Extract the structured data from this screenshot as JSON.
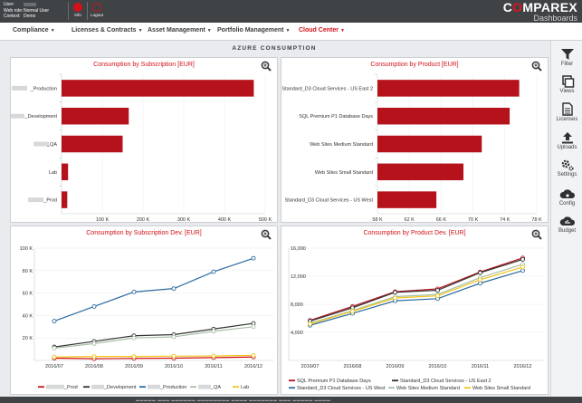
{
  "header": {
    "user_label": "User:",
    "role_label": "Web role:",
    "role_value": "Normal User",
    "context_label": "Context:",
    "context_value": "Demo",
    "info_label": "Info",
    "logout_label": "Logout",
    "brand_name_pre": "C",
    "brand_name_o": "O",
    "brand_name_post": "MPAREX",
    "brand_sub": "Dashboards"
  },
  "nav": {
    "items": [
      {
        "label": "Compliance"
      },
      {
        "label": "Licenses & Contracts"
      },
      {
        "label": "Asset Management"
      },
      {
        "label": "Portfolio Management"
      },
      {
        "label": "Cloud Center"
      }
    ],
    "active_index": 4,
    "active_color": "#d11218"
  },
  "page": {
    "title": "AZURE CONSUMPTION"
  },
  "sidebar": {
    "items": [
      {
        "label": "Filter",
        "icon": "filter-icon"
      },
      {
        "label": "Views",
        "icon": "views-icon"
      },
      {
        "label": "Licenses",
        "icon": "licenses-icon"
      },
      {
        "label": "Uploads",
        "icon": "upload-icon"
      },
      {
        "label": "Settings",
        "icon": "settings-icon"
      },
      {
        "label": "Config",
        "icon": "cloud-config-icon"
      },
      {
        "label": "Budget",
        "icon": "budget-icon"
      }
    ]
  },
  "colors": {
    "bar": "#b5121b",
    "accent": "#d11218"
  },
  "chart_data": [
    {
      "type": "bar",
      "orientation": "horizontal",
      "title": "Consumption by Subscription [EUR]",
      "categories": [
        "_Production",
        "_Development",
        "_QA",
        "Lab",
        "_Prod"
      ],
      "values": [
        472000,
        165000,
        150000,
        16000,
        14000
      ],
      "xlim": [
        0,
        500000
      ],
      "xticks": [
        "100 K",
        "200 K",
        "300 K",
        "400 K",
        "500 K"
      ],
      "xtick_values": [
        100000,
        200000,
        300000,
        400000,
        500000
      ]
    },
    {
      "type": "bar",
      "orientation": "horizontal",
      "title": "Consumption by Product [EUR]",
      "categories": [
        "Standard_D3 Cloud Services - US East 2",
        "SQL Premium P1 Database Days",
        "Web Sites Medium Standard",
        "Web Sites Small Standard",
        "Standard_D3 Cloud Services - US West"
      ],
      "values": [
        75800,
        74600,
        71100,
        68800,
        65400
      ],
      "xlim": [
        58000,
        78000
      ],
      "xticks": [
        "58 K",
        "62 K",
        "66 K",
        "70 K",
        "74 K",
        "78 K"
      ],
      "xtick_values": [
        58000,
        62000,
        66000,
        70000,
        74000,
        78000
      ]
    },
    {
      "type": "line",
      "title": "Consumption by Subscription Dev. [EUR]",
      "x": [
        "2016/07",
        "2016/08",
        "2016/09",
        "2016/10",
        "2016/11",
        "2016/12"
      ],
      "ylim": [
        0,
        100000
      ],
      "yticks": [
        "20 K",
        "40 K",
        "60 K",
        "80 K",
        "100 K"
      ],
      "ytick_values": [
        20000,
        40000,
        60000,
        80000,
        100000
      ],
      "series": [
        {
          "name": "_Prod",
          "color": "#d11218",
          "values": [
            2000,
            1500,
            1800,
            2000,
            2500,
            3000
          ]
        },
        {
          "name": "_Development",
          "color": "#333333",
          "values": [
            12000,
            17000,
            22000,
            23000,
            28000,
            33000
          ]
        },
        {
          "name": "_Production",
          "color": "#2e6aa0",
          "values": [
            35000,
            48000,
            61000,
            64000,
            79000,
            91000
          ]
        },
        {
          "name": "_QA",
          "color": "#a8bfa8",
          "values": [
            11000,
            15000,
            20000,
            21000,
            26000,
            30000
          ]
        },
        {
          "name": "Lab",
          "color": "#f0c419",
          "values": [
            3000,
            3500,
            3500,
            3800,
            4000,
            4500
          ]
        }
      ]
    },
    {
      "type": "line",
      "title": "Consumption by Product Dev. [EUR]",
      "x": [
        "2016/07",
        "2016/08",
        "2016/09",
        "2016/10",
        "2016/11",
        "2016/12"
      ],
      "ylim": [
        0,
        16000
      ],
      "yticks": [
        "4,000",
        "8,000",
        "12,000",
        "16,000"
      ],
      "ytick_values": [
        4000,
        8000,
        12000,
        16000
      ],
      "series": [
        {
          "name": "SQL Premium P1 Database Days",
          "color": "#b5121b",
          "values": [
            5700,
            7700,
            9800,
            10200,
            12600,
            14600
          ]
        },
        {
          "name": "Standard_D3 Cloud Services - US East 2",
          "color": "#333333",
          "values": [
            5600,
            7500,
            9700,
            10000,
            12500,
            14400
          ]
        },
        {
          "name": "Standard_D3 Cloud Services - US West",
          "color": "#2e6aa0",
          "values": [
            5000,
            6700,
            8500,
            8800,
            11000,
            12800
          ]
        },
        {
          "name": "Web Sites Medium Standard",
          "color": "#a8bfa8",
          "values": [
            5300,
            7100,
            9100,
            9400,
            11800,
            13700
          ]
        },
        {
          "name": "Web Sites Small Standard",
          "color": "#f0c419",
          "values": [
            5200,
            7000,
            8900,
            9200,
            11500,
            13300
          ]
        }
      ]
    }
  ]
}
